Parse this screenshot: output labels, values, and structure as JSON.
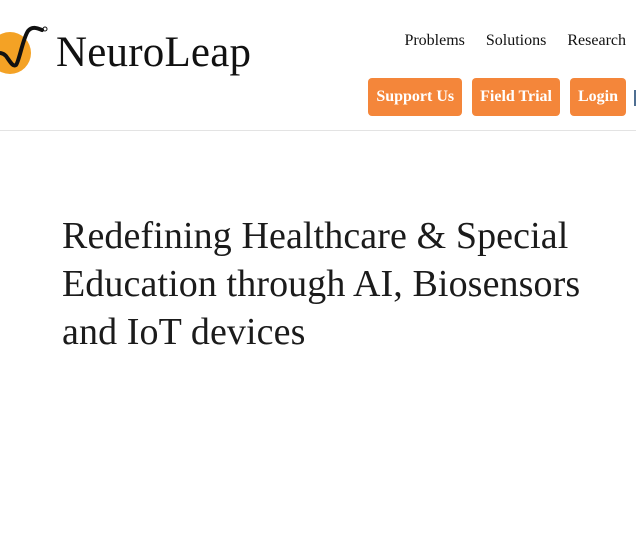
{
  "brand": {
    "name": "NeuroLeap",
    "logo_icon": "neuroleap-logo-icon",
    "accent_color": "#f4a225"
  },
  "nav": {
    "items": [
      {
        "label": "Problems"
      },
      {
        "label": "Solutions"
      },
      {
        "label": "Research"
      }
    ]
  },
  "actions": {
    "support_label": "Support Us",
    "field_trial_label": "Field Trial",
    "login_label": "Login",
    "button_color": "#f4863a"
  },
  "hero": {
    "title": "Redefining Healthcare & Special Education through AI, Biosensors and IoT devices"
  }
}
